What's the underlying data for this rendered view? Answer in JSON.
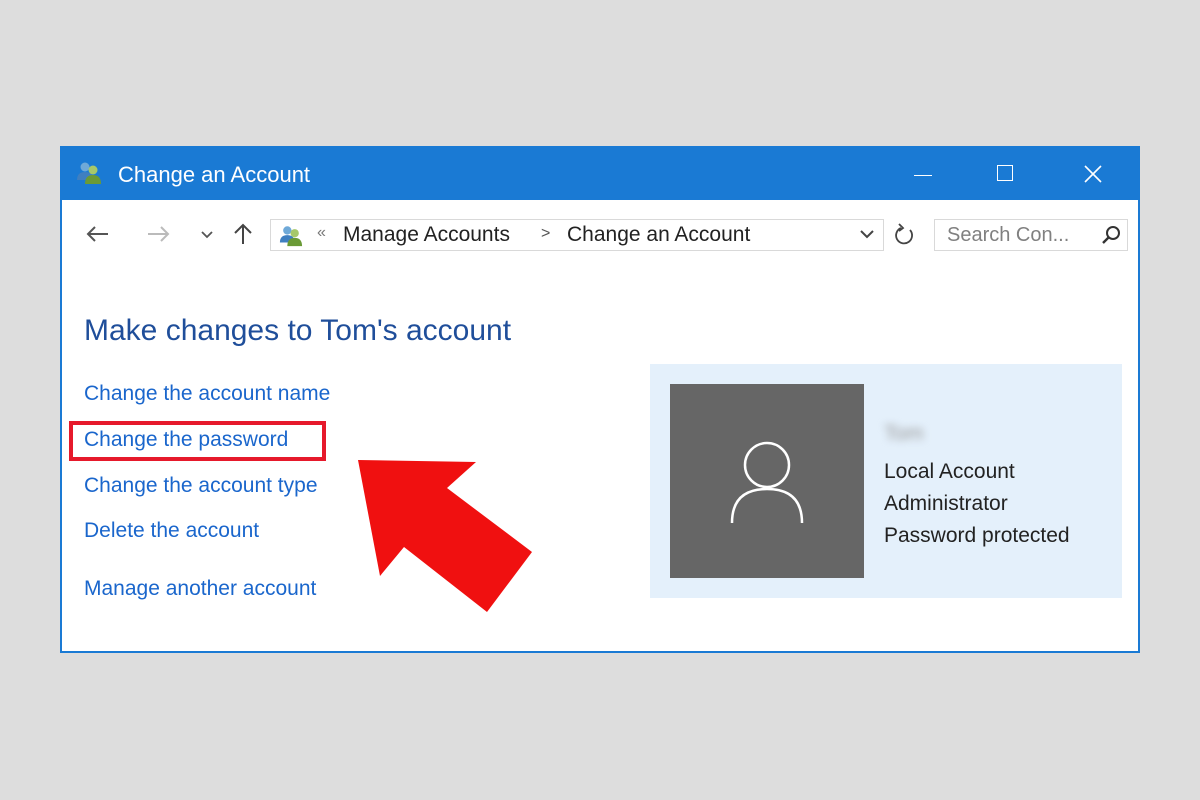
{
  "window": {
    "title": "Change an Account",
    "icon": "users-icon"
  },
  "navigation": {
    "breadcrumbs": [
      "Manage Accounts",
      "Change an Account"
    ],
    "breadcrumb_separator": ">",
    "overflow_separator": "«",
    "search_placeholder": "Search Con..."
  },
  "main": {
    "heading": "Make changes to Tom's account",
    "links": [
      "Change the account name",
      "Change the password",
      "Change the account type",
      "Delete the account",
      "Manage another account"
    ],
    "highlighted_link": "Change the password"
  },
  "account": {
    "name": "Tom",
    "type": "Local Account",
    "role": "Administrator",
    "protection": "Password protected"
  },
  "colors": {
    "titlebar": "#1a7ad4",
    "link": "#1a66cc",
    "heading": "#1f4e9a",
    "highlight": "#e6192b",
    "arrow": "#f01010",
    "card_bg": "#e4f0fb",
    "avatar_bg": "#666666"
  }
}
